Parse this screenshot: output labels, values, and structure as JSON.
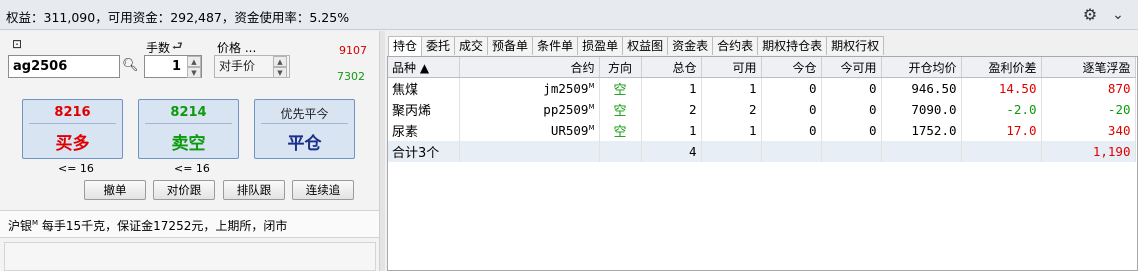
{
  "header": {
    "summary": "权益：311,090，可用资金：292,487，资金使用率：5.25%"
  },
  "order_panel": {
    "qty_label": "手数",
    "price_label": "价格 ...",
    "ask_price": "9107",
    "bid_price": "7302",
    "symbol": "ag2506",
    "quantity": "1",
    "price_mode": "对手价",
    "buy": {
      "price": "8216",
      "label": "买多",
      "limit": "<= 16"
    },
    "sell": {
      "price": "8214",
      "label": "卖空",
      "limit": "<= 16"
    },
    "close": {
      "title": "优先平今",
      "label": "平仓"
    },
    "buttons": {
      "cancel": "撤单",
      "counter_follow": "对价跟",
      "queue_follow": "排队跟",
      "chase": "连续追"
    },
    "info_symbol": "沪银",
    "info_mark": "M",
    "info_text": "每手15千克，保证金17252元，上期所，闭市"
  },
  "tabs": [
    "持仓",
    "委托",
    "成交",
    "预备单",
    "条件单",
    "损盈单",
    "权益图",
    "资金表",
    "合约表",
    "期权持仓表",
    "期权行权"
  ],
  "positions": {
    "headers": [
      "品种 ▲",
      "合约",
      "方向",
      "总仓",
      "可用",
      "今仓",
      "今可用",
      "开仓均价",
      "盈利价差",
      "逐笔浮盈"
    ],
    "rows": [
      {
        "name": "焦煤",
        "contract": "jm2509",
        "mark": "M",
        "direction": "空",
        "total": "1",
        "available": "1",
        "today": "0",
        "today_available": "0",
        "avg_price": "946.50",
        "spread": "14.50",
        "pnl": "870"
      },
      {
        "name": "聚丙烯",
        "contract": "pp2509",
        "mark": "M",
        "direction": "空",
        "total": "2",
        "available": "2",
        "today": "0",
        "today_available": "0",
        "avg_price": "7090.0",
        "spread": "-2.0",
        "pnl": "-20"
      },
      {
        "name": "尿素",
        "contract": "UR509",
        "mark": "M",
        "direction": "空",
        "total": "1",
        "available": "1",
        "today": "0",
        "today_available": "0",
        "avg_price": "1752.0",
        "spread": "17.0",
        "pnl": "340"
      }
    ],
    "total": {
      "label": "合计3个",
      "total": "4",
      "pnl": "1,190"
    }
  },
  "colors": {
    "profit": "#e00000",
    "loss": "#0d9a0d",
    "accent": "#1a2f8a"
  }
}
